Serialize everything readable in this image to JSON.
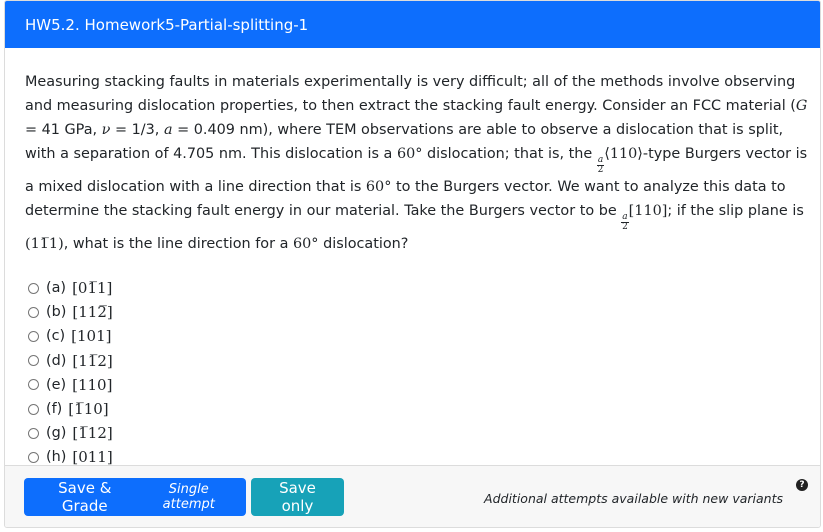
{
  "header": {
    "title": "HW5.2. Homework5-Partial-splitting-1"
  },
  "question": {
    "s1": "Measuring stacking faults in materials experimentally is very difficult; all of the methods involve observing and measuring dislocation properties, to then extract the stacking fault energy. Consider an FCC material (",
    "G_sym": "G",
    "s2": " = 41 GPa, ",
    "nu_sym": "ν",
    "s3": " = 1/3, ",
    "a_sym": "a",
    "s4": " = 0.409 nm), where TEM observations are able to observe a dislocation that is split, with a separation of 4.705 nm. This dislocation is a ",
    "angle1": "60°",
    "s5": " dislocation; that is, the ",
    "frac_num": "a",
    "frac_den": "2",
    "family": "⟨110⟩",
    "s6": "-type Burgers vector is a mixed dislocation with a line direction that is ",
    "angle2": "60°",
    "s7": " to the Burgers vector. We want to analyze this data to determine the stacking fault energy in our material. Take the Burgers vector to be ",
    "frac2_num": "a",
    "frac2_den": "2",
    "burgers": "[110]",
    "s8": "; if the slip plane is ",
    "plane": "(11̅1)",
    "s9": ", what is the line direction for a ",
    "angle3": "60°",
    "s10": " dislocation?"
  },
  "options": [
    {
      "label": "(a)",
      "value": "[01̅1]"
    },
    {
      "label": "(b)",
      "value": "[112̅]"
    },
    {
      "label": "(c)",
      "value": "[101]"
    },
    {
      "label": "(d)",
      "value": "[11̅2]"
    },
    {
      "label": "(e)",
      "value": "[110]"
    },
    {
      "label": "(f)",
      "value": "[1̅10]"
    },
    {
      "label": "(g)",
      "value": "[1̅12]"
    },
    {
      "label": "(h)",
      "value": "[011]"
    }
  ],
  "footer": {
    "save_grade_label": "Save & Grade",
    "single_attempt": "Single attempt",
    "save_only_label": "Save only",
    "attempts_note": "Additional attempts available with new variants",
    "help_glyph": "?"
  },
  "colors": {
    "primary": "#0d6efd",
    "info": "#17a2b8"
  }
}
